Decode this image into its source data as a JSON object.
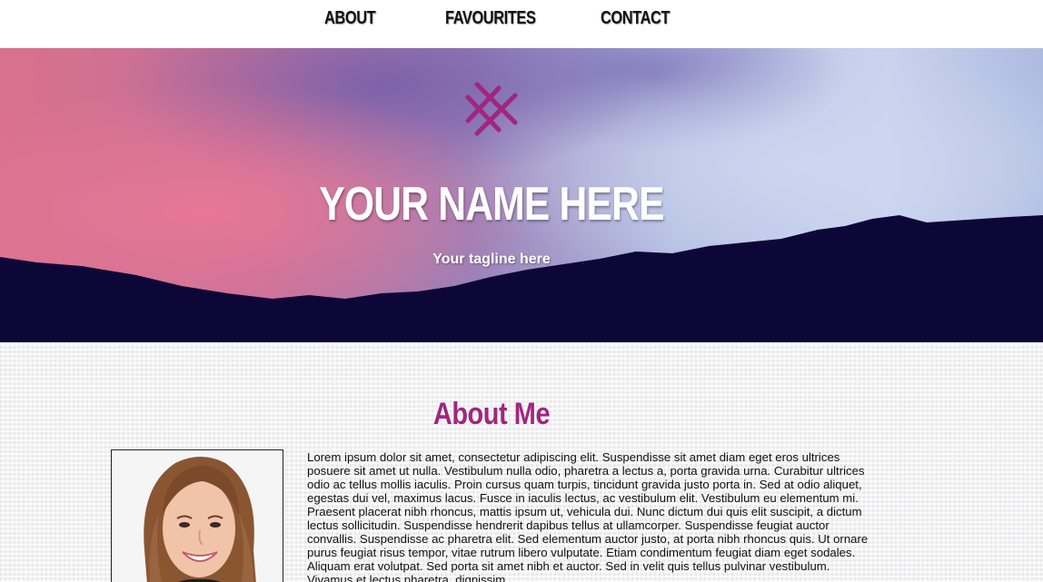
{
  "nav": {
    "items": [
      {
        "label": "ABOUT"
      },
      {
        "label": "FAVOURITES"
      },
      {
        "label": "CONTACT"
      }
    ]
  },
  "hero": {
    "logo_icon": "crosshatch-logo-icon",
    "title": "YOUR NAME HERE",
    "tagline": "Your tagline here"
  },
  "about": {
    "title": "About Me",
    "image_alt": "profile photo of a smiling woman",
    "text": "Lorem ipsum dolor sit amet, consectetur adipiscing elit. Suspendisse sit amet diam eget eros ultrices posuere sit amet ut nulla. Vestibulum nulla odio, pharetra a lectus a, porta gravida urna. Curabitur ultrices odio ac tellus mollis iaculis. Proin cursus quam turpis, tincidunt gravida justo porta in. Sed at odio aliquet, egestas dui vel, maximus lacus. Fusce in iaculis lectus, ac vestibulum elit. Vestibulum eu elementum mi. Praesent placerat nibh rhoncus, mattis ipsum ut, vehicula dui. Nunc dictum dui quis elit suscipit, a dictum lectus sollicitudin. Suspendisse hendrerit dapibus tellus at ullamcorper. Suspendisse feugiat auctor convallis. Suspendisse ac pharetra elit. Sed elementum auctor justo, at porta nibh rhoncus quis. Ut ornare purus feugiat risus tempor, vitae rutrum libero vulputate. Etiam condimentum feugiat diam eget sodales. Aliquam erat volutpat. Sed porta sit amet nibh et auctor. Sed in velit quis tellus pulvinar vestibulum. Vivamus et lectus pharetra, dignissim"
  },
  "colors": {
    "accent": "#a0267f",
    "mountains": "#0d0738",
    "nav_bg": "#ffffff"
  }
}
